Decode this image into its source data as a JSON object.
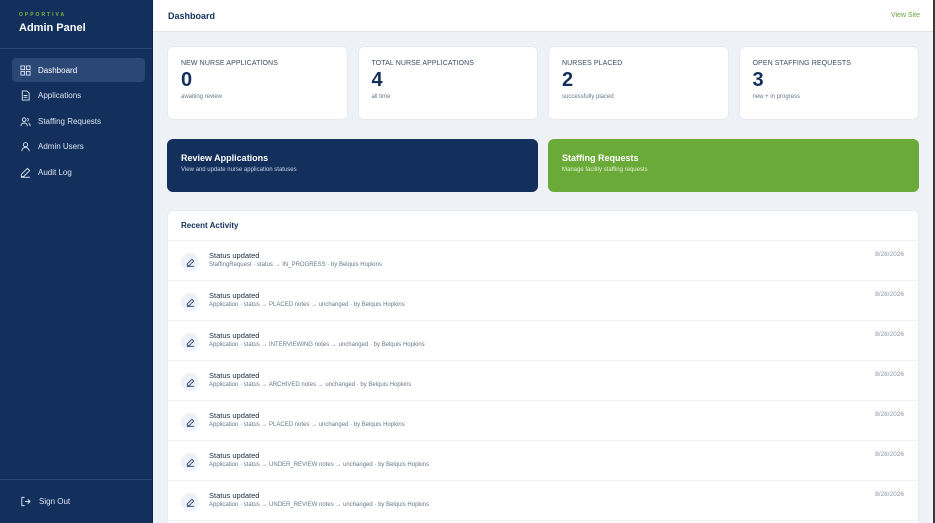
{
  "sidebar": {
    "brand_small": "OPPORTIVA",
    "brand_title": "Admin Panel",
    "items": [
      {
        "label": "Dashboard",
        "icon": "grid-icon"
      },
      {
        "label": "Applications",
        "icon": "document-icon"
      },
      {
        "label": "Staffing Requests",
        "icon": "users-icon"
      },
      {
        "label": "Admin Users",
        "icon": "user-icon"
      },
      {
        "label": "Audit Log",
        "icon": "pencil-icon"
      }
    ],
    "sign_out": "Sign Out"
  },
  "header": {
    "title": "Dashboard",
    "view_site": "View Site"
  },
  "stats": [
    {
      "label": "NEW NURSE APPLICATIONS",
      "value": "0",
      "sub": "awaiting review"
    },
    {
      "label": "TOTAL NURSE APPLICATIONS",
      "value": "4",
      "sub": "all time"
    },
    {
      "label": "NURSES PLACED",
      "value": "2",
      "sub": "successfully placed"
    },
    {
      "label": "OPEN STAFFING REQUESTS",
      "value": "3",
      "sub": "new + in progress"
    }
  ],
  "actions": [
    {
      "title": "Review Applications",
      "desc": "View and update nurse application statuses"
    },
    {
      "title": "Staffing Requests",
      "desc": "Manage facility staffing requests"
    }
  ],
  "activity": {
    "title": "Recent Activity",
    "rows": [
      {
        "title": "Status updated",
        "detail": "StaffingRequest · status → IN_PROGRESS · by Belquis Hopkins",
        "date": "8/28/2026"
      },
      {
        "title": "Status updated",
        "detail": "Application · status → PLACED notes → unchanged · by Belquis Hopkins",
        "date": "8/28/2026"
      },
      {
        "title": "Status updated",
        "detail": "Application · status → INTERVIEWING notes → unchanged · by Belquis Hopkins",
        "date": "8/28/2026"
      },
      {
        "title": "Status updated",
        "detail": "Application · status → ARCHIVED notes → unchanged · by Belquis Hopkins",
        "date": "8/28/2026"
      },
      {
        "title": "Status updated",
        "detail": "Application · status → PLACED notes → unchanged · by Belquis Hopkins",
        "date": "8/28/2026"
      },
      {
        "title": "Status updated",
        "detail": "Application · status → UNDER_REVIEW notes → unchanged · by Belquis Hopkins",
        "date": "8/28/2026"
      },
      {
        "title": "Status updated",
        "detail": "Application · status → UNDER_REVIEW notes → unchanged · by Belquis Hopkins",
        "date": "8/28/2026"
      }
    ]
  },
  "colors": {
    "sidebar_bg": "#13305c",
    "accent_green": "#6aaa38",
    "navy": "#13305c"
  }
}
